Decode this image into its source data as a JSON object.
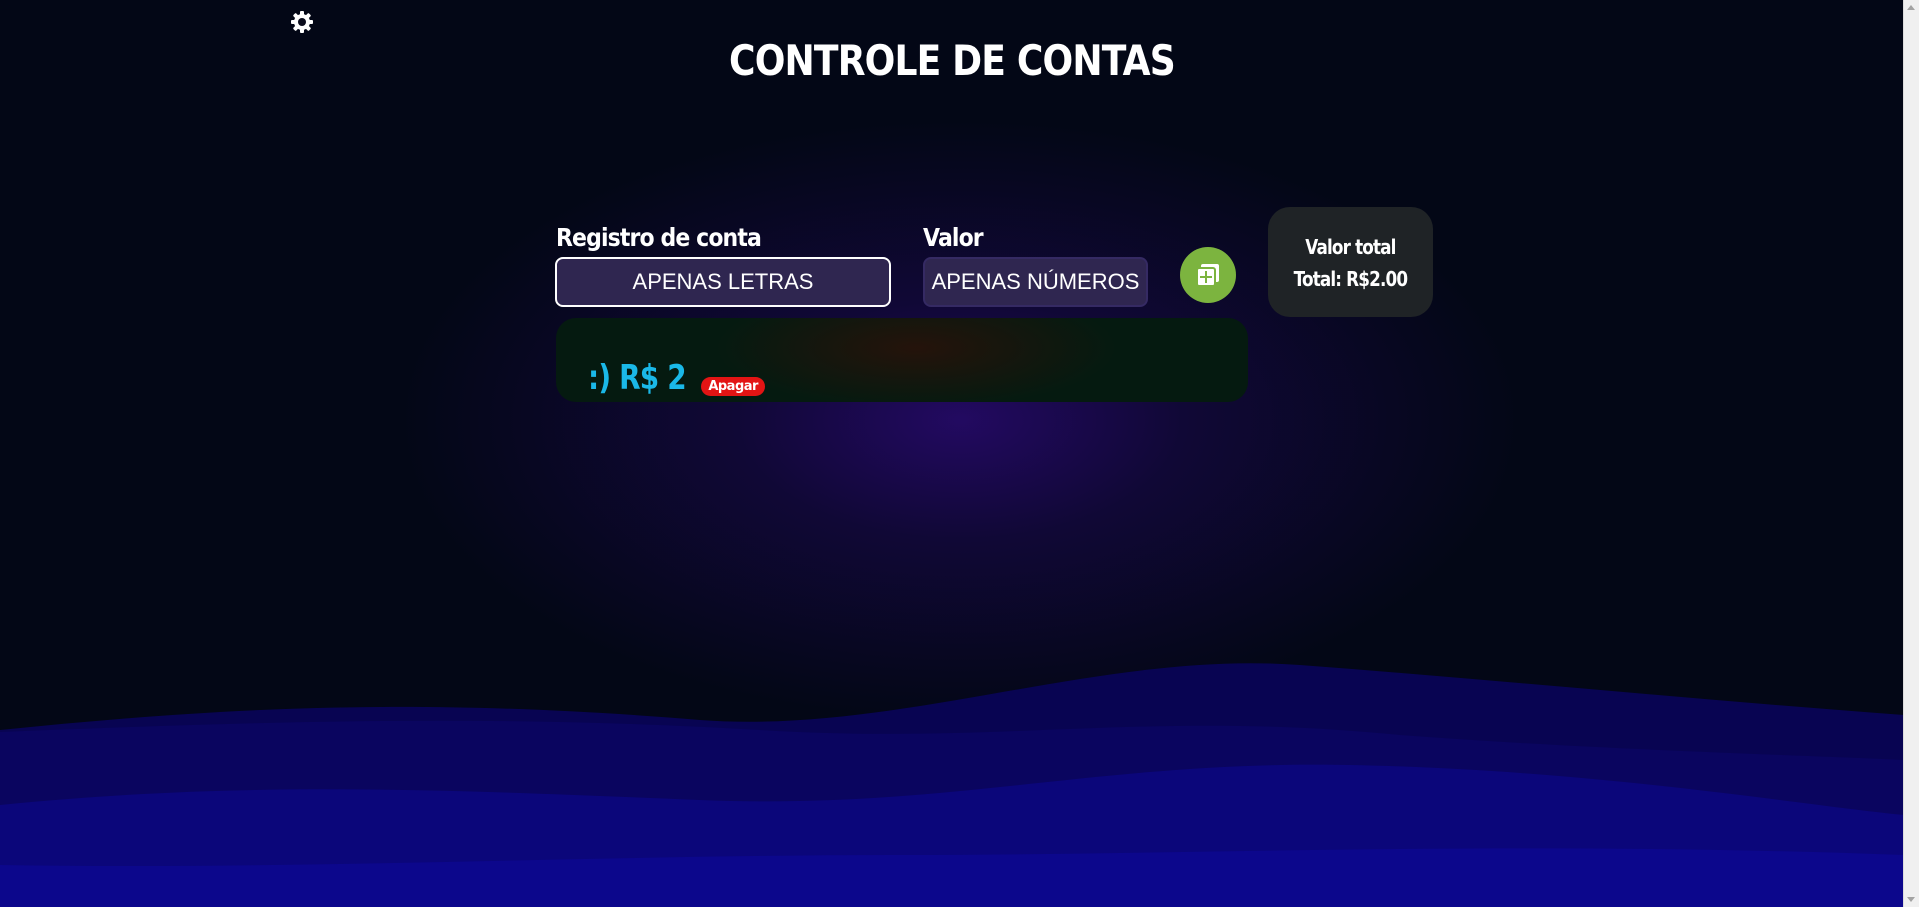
{
  "header": {
    "title": "CONTROLE DE CONTAS",
    "settings_icon": "gear-icon"
  },
  "form": {
    "registro_label": "Registro de conta",
    "registro_placeholder": "APENAS LETRAS",
    "valor_label": "Valor",
    "valor_placeholder": "APENAS NÚMEROS",
    "add_button_icon": "add-copy-icon"
  },
  "total": {
    "label": "Valor total",
    "value": "Total: R$2.00"
  },
  "entries": [
    {
      "text": ":) R$ 2",
      "delete_label": "Apagar"
    }
  ],
  "colors": {
    "accent_green": "#7cb43f",
    "entry_value": "#1ab8e8",
    "delete_red": "#e31414",
    "input_bg": "#2f2650"
  }
}
